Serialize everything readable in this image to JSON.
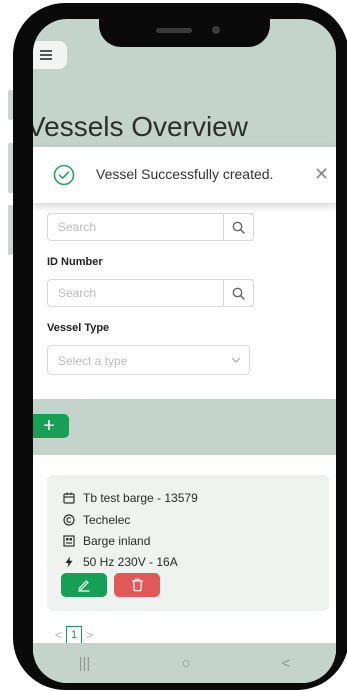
{
  "header": {
    "title": "Vessels Overview"
  },
  "toast": {
    "message": "Vessel Successfully created."
  },
  "filters": {
    "search_placeholder": "Search",
    "id_label": "ID Number",
    "id_placeholder": "Search",
    "type_label": "Vessel Type",
    "type_placeholder": "Select a type"
  },
  "actions": {
    "add_label": "+"
  },
  "vessel_card": {
    "name": "Tb test barge - 13579",
    "company": "Techelec",
    "category": "Barge inland",
    "power": "50 Hz 230V - 16A"
  },
  "pagination": {
    "prev": "<",
    "current": "1",
    "next": ">"
  },
  "nav": {
    "recent": "|||",
    "home": "○",
    "back": "<"
  },
  "colors": {
    "primary_green": "#17a055",
    "danger_red": "#e05959",
    "background_sage": "#c5d3cd"
  }
}
